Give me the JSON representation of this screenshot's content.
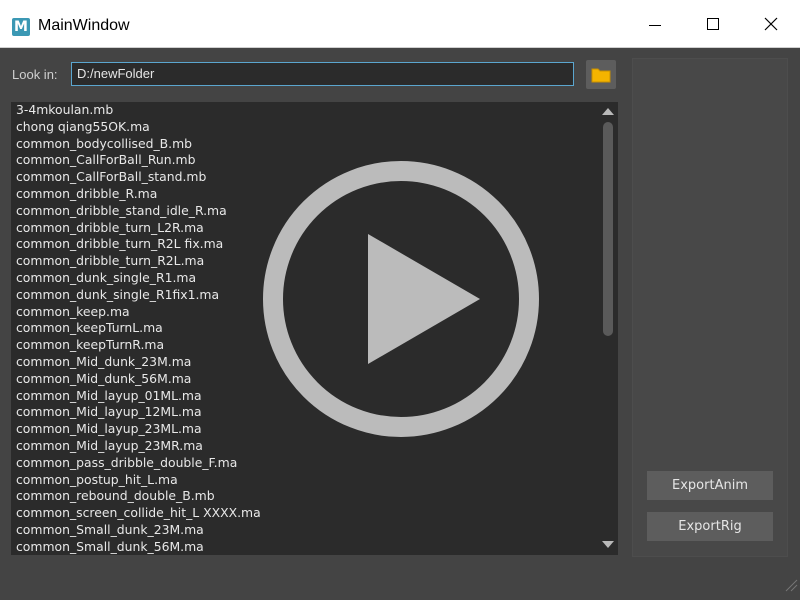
{
  "window": {
    "title": "MainWindow",
    "app_icon_letter": "M",
    "icons": [
      "maya-app-icon",
      "minimize-icon",
      "maximize-icon",
      "close-icon"
    ]
  },
  "lookin": {
    "label": "Look in:",
    "path_value": "D:/newFolder",
    "browse_icon": "folder-icon"
  },
  "files": [
    "3-4mkoulan.mb",
    "chong qiang55OK.ma",
    "common_bodycollised_B.mb",
    "common_CallForBall_Run.mb",
    "common_CallForBall_stand.mb",
    "common_dribble_R.ma",
    "common_dribble_stand_idle_R.ma",
    "common_dribble_turn_L2R.ma",
    "common_dribble_turn_R2L fix.ma",
    "common_dribble_turn_R2L.ma",
    "common_dunk_single_R1.ma",
    "common_dunk_single_R1fix1.ma",
    "common_keep.ma",
    "common_keepTurnL.ma",
    "common_keepTurnR.ma",
    "common_Mid_dunk_23M.ma",
    "common_Mid_dunk_56M.ma",
    "common_Mid_layup_01ML.ma",
    "common_Mid_layup_12ML.ma",
    "common_Mid_layup_23ML.ma",
    "common_Mid_layup_23MR.ma",
    "common_pass_dribble_double_F.ma",
    "common_postup_hit_L.ma",
    "common_rebound_double_B.mb",
    "common_screen_collide_hit_L XXXX.ma",
    "common_Small_dunk_23M.ma",
    "common_Small_dunk_56M.ma"
  ],
  "actions": {
    "export_anim": "ExportAnim",
    "export_rig": "ExportRig"
  },
  "colors": {
    "window_bg": "#444444",
    "list_bg": "#2b2b2b",
    "input_focus_border": "#5ba6cf",
    "button_bg": "#5d5d5d",
    "folder_icon": "#f4b400",
    "play_overlay": "#c8c8c8"
  }
}
